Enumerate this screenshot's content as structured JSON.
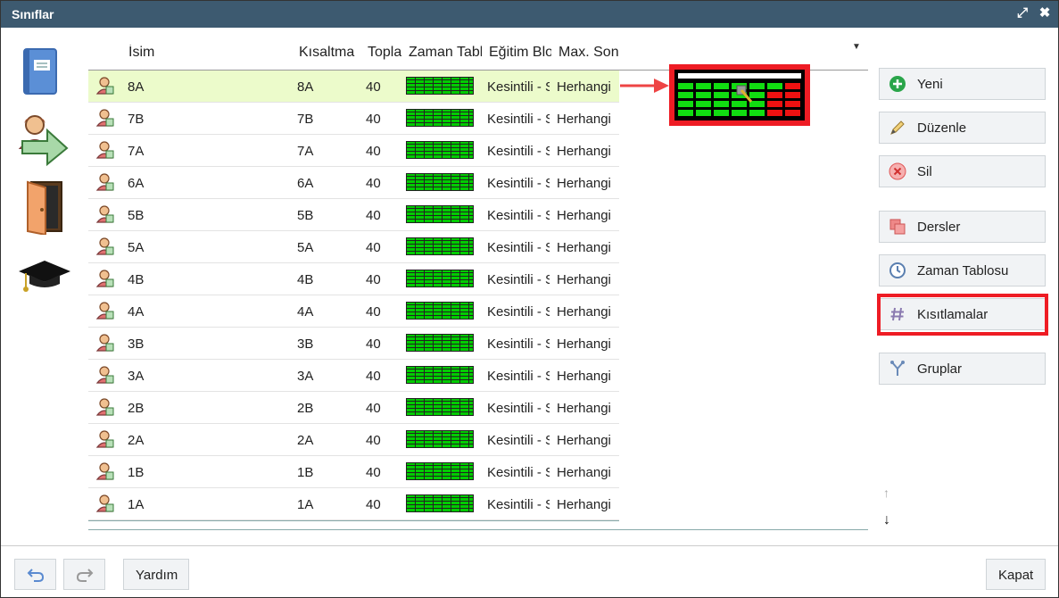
{
  "window": {
    "title": "Sınıflar",
    "maximize_glyph": "⤢",
    "close_glyph": "✖"
  },
  "columns": [
    "İsim",
    "Kısaltma",
    "Toplam",
    "Zaman Tablosu",
    "Eğitim Blokları",
    "Max. Sonuç"
  ],
  "rows": [
    {
      "name": "8A",
      "short": "8A",
      "total": "40",
      "edu": "Kesintili - Sınıf",
      "max": "Herhangi"
    },
    {
      "name": "7B",
      "short": "7B",
      "total": "40",
      "edu": "Kesintili - Sınıf",
      "max": "Herhangi"
    },
    {
      "name": "7A",
      "short": "7A",
      "total": "40",
      "edu": "Kesintili - Sınıf",
      "max": "Herhangi"
    },
    {
      "name": "6A",
      "short": "6A",
      "total": "40",
      "edu": "Kesintili - Sınıf",
      "max": "Herhangi"
    },
    {
      "name": "5B",
      "short": "5B",
      "total": "40",
      "edu": "Kesintili - Sınıf",
      "max": "Herhangi"
    },
    {
      "name": "5A",
      "short": "5A",
      "total": "40",
      "edu": "Kesintili - Sınıf",
      "max": "Herhangi"
    },
    {
      "name": "4B",
      "short": "4B",
      "total": "40",
      "edu": "Kesintili - Sınıf",
      "max": "Herhangi"
    },
    {
      "name": "4A",
      "short": "4A",
      "total": "40",
      "edu": "Kesintili - Sınıf",
      "max": "Herhangi"
    },
    {
      "name": "3B",
      "short": "3B",
      "total": "40",
      "edu": "Kesintili - Sınıf",
      "max": "Herhangi"
    },
    {
      "name": "3A",
      "short": "3A",
      "total": "40",
      "edu": "Kesintili - Sınıf",
      "max": "Herhangi"
    },
    {
      "name": "2B",
      "short": "2B",
      "total": "40",
      "edu": "Kesintili - Sınıf",
      "max": "Herhangi"
    },
    {
      "name": "2A",
      "short": "2A",
      "total": "40",
      "edu": "Kesintili - Sınıf",
      "max": "Herhangi"
    },
    {
      "name": "1B",
      "short": "1B",
      "total": "40",
      "edu": "Kesintili - Sınıf",
      "max": "Herhangi"
    },
    {
      "name": "1A",
      "short": "1A",
      "total": "40",
      "edu": "Kesintili - Sınıf",
      "max": "Herhangi"
    }
  ],
  "selected_row": 0,
  "actions": {
    "new": "Yeni",
    "edit": "Düzenle",
    "delete": "Sil",
    "lessons": "Dersler",
    "timetable": "Zaman Tablosu",
    "constraints": "Kısıtlamalar",
    "groups": "Gruplar"
  },
  "footer": {
    "help": "Yardım",
    "close": "Kapat"
  },
  "sidebar_icons": [
    "notebook-icon",
    "teacher-transfer-icon",
    "door-icon",
    "graduation-cap-icon"
  ],
  "colors": {
    "titlebar": "#3d5a70",
    "selected_row": "#ecfbcb",
    "highlight": "#ee1c24",
    "timetable_cell": "#00cc00"
  },
  "scroll": {
    "up": "↑",
    "down": "↓"
  }
}
